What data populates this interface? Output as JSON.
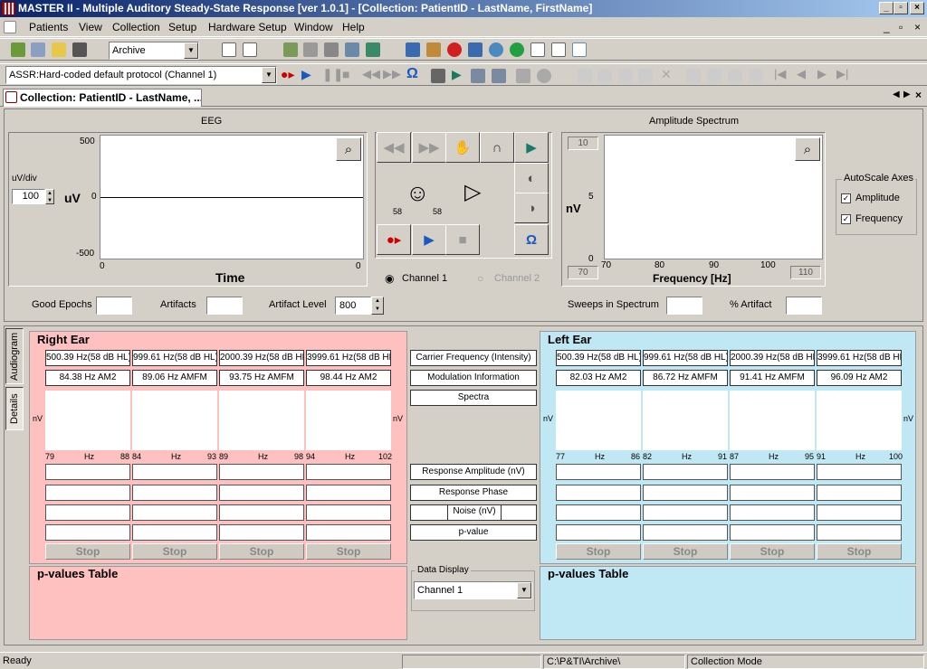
{
  "window": {
    "title": "MASTER II - Multiple Auditory Steady-State Response [ver 1.0.1] - [Collection: PatientID - LastName, FirstName]"
  },
  "menu": [
    "Patients",
    "View",
    "Collection",
    "Setup",
    "Hardware Setup",
    "Window",
    "Help"
  ],
  "toolbar": {
    "archive_combo": "Archive",
    "protocol_combo": "ASSR:Hard-coded default protocol (Channel 1)"
  },
  "doc_tab": {
    "label": "Collection: PatientID - LastName, ..."
  },
  "eeg": {
    "title": "EEG",
    "unit_div_label": "uV/div",
    "unit_div_value": "100",
    "y_unit": "uV",
    "y_max": "500",
    "y_zero": "0",
    "y_min": "-500",
    "x_min": "0",
    "x_max": "0",
    "x_label": "Time"
  },
  "control": {
    "left_level": "58",
    "right_level": "58",
    "channel1": "Channel 1",
    "channel2": "Channel 2"
  },
  "spectrum": {
    "title": "Amplitude Spectrum",
    "y_unit": "nV",
    "y_top": "10",
    "y_mid": "5",
    "y_zero": "0",
    "x_label": "Frequency [Hz]",
    "x_ticks": [
      "70",
      "80",
      "90",
      "100"
    ],
    "x_min_box": "70",
    "x_max_box": "110"
  },
  "autoscale": {
    "title": "AutoScale Axes",
    "amplitude": "Amplitude",
    "frequency": "Frequency"
  },
  "stats": {
    "good_epochs": "Good Epochs",
    "artifacts": "Artifacts",
    "artifact_level": "Artifact Level",
    "artifact_level_value": "800",
    "sweeps": "Sweeps in Spectrum",
    "pct_artifact": "% Artifact"
  },
  "side_tabs": {
    "audiogram": "Audiogram",
    "details": "Details"
  },
  "right_ear": {
    "title": "Right Ear",
    "carriers": [
      "500.39 Hz(58 dB HL)",
      "999.61 Hz(58 dB HL)",
      "2000.39 Hz(58 dB HL)",
      "3999.61 Hz(58 dB HL)"
    ],
    "mods": [
      "84.38 Hz AM2",
      "89.06 Hz AMFM",
      "93.75 Hz AMFM",
      "98.44 Hz AM2"
    ],
    "axes": [
      [
        "79",
        "Hz",
        "88"
      ],
      [
        "84",
        "Hz",
        "93"
      ],
      [
        "89",
        "Hz",
        "98"
      ],
      [
        "94",
        "Hz",
        "102"
      ]
    ],
    "stop": "Stop",
    "nv": "nV",
    "pvalues": "p-values Table"
  },
  "left_ear": {
    "title": "Left Ear",
    "carriers": [
      "500.39 Hz(58 dB HL)",
      "999.61 Hz(58 dB HL)",
      "2000.39 Hz(58 dB HL)",
      "3999.61 Hz(58 dB HL)"
    ],
    "mods": [
      "82.03 Hz AM2",
      "86.72 Hz AMFM",
      "91.41 Hz AMFM",
      "96.09 Hz AM2"
    ],
    "axes": [
      [
        "77",
        "Hz",
        "86"
      ],
      [
        "82",
        "Hz",
        "91"
      ],
      [
        "87",
        "Hz",
        "95"
      ],
      [
        "91",
        "Hz",
        "100"
      ]
    ],
    "stop": "Stop",
    "nv": "nV",
    "pvalues": "p-values Table"
  },
  "middle": {
    "carrier": "Carrier Frequency (Intensity)",
    "modulation": "Modulation Information",
    "spectra": "Spectra",
    "amplitude": "Response Amplitude (nV)",
    "phase": "Response Phase",
    "noise": "Noise (nV)",
    "pvalue": "p-value",
    "data_display": "Data Display",
    "data_display_value": "Channel 1"
  },
  "statusbar": {
    "ready": "Ready",
    "path": "C:\\P&TI\\Archive\\",
    "mode": "Collection Mode"
  },
  "colors": {
    "right_bg": "#ffc0c0",
    "left_bg": "#c0e8f4",
    "title_start": "#0a246a",
    "title_end": "#a6caf0"
  }
}
